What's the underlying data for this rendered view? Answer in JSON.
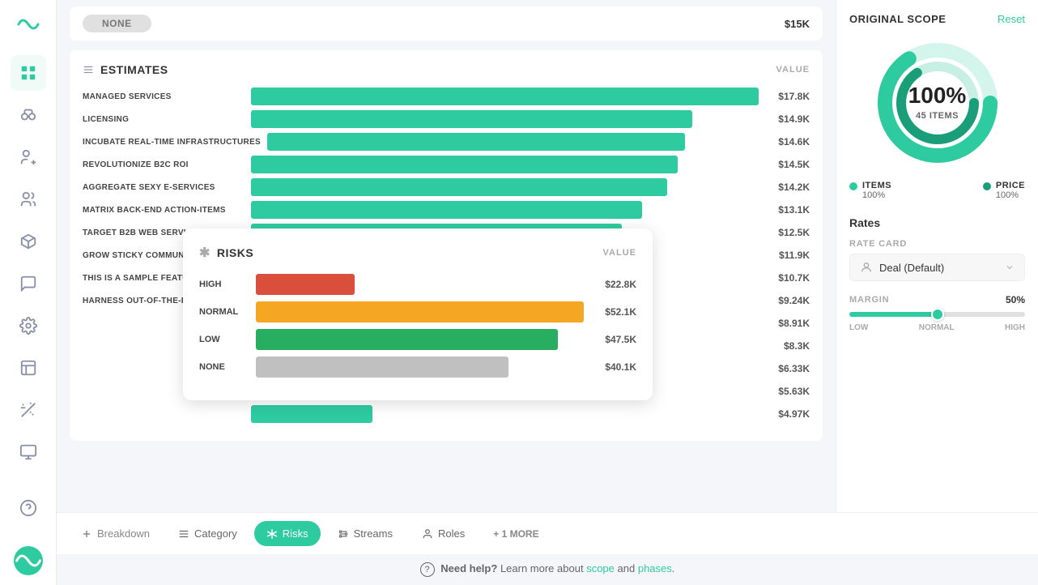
{
  "sidebar": {
    "logo_label": "~",
    "items": [
      {
        "name": "apps",
        "icon": "grid",
        "active": true
      },
      {
        "name": "binoculars",
        "icon": "binoculars"
      },
      {
        "name": "user-money",
        "icon": "user-money"
      },
      {
        "name": "users",
        "icon": "users"
      },
      {
        "name": "cube",
        "icon": "cube"
      },
      {
        "name": "chat",
        "icon": "chat"
      },
      {
        "name": "settings",
        "icon": "settings"
      },
      {
        "name": "building",
        "icon": "building"
      },
      {
        "name": "wand",
        "icon": "wand"
      },
      {
        "name": "display",
        "icon": "display"
      },
      {
        "name": "help",
        "icon": "help"
      }
    ]
  },
  "top_bar": {
    "none_label": "NONE",
    "price": "$15K"
  },
  "estimates": {
    "title": "ESTIMATES",
    "value_label": "VALUE",
    "bars": [
      {
        "label": "MANAGED SERVICES",
        "value": "$17.8K",
        "pct": 100
      },
      {
        "label": "LICENSING",
        "value": "$14.9K",
        "pct": 87
      },
      {
        "label": "INCUBATE REAL-TIME INFRASTRUCTURES",
        "value": "$14.6K",
        "pct": 85
      },
      {
        "label": "REVOLUTIONIZE B2C ROI",
        "value": "$14.5K",
        "pct": 84
      },
      {
        "label": "AGGREGATE SEXY E-SERVICES",
        "value": "$14.2K",
        "pct": 82
      },
      {
        "label": "MATRIX BACK-END ACTION-ITEMS",
        "value": "$13.1K",
        "pct": 77
      },
      {
        "label": "TARGET B2B WEB SERVICES",
        "value": "$12.5K",
        "pct": 73
      },
      {
        "label": "GROW STICKY COMMUNITIES",
        "value": "$11.9K",
        "pct": 70
      },
      {
        "label": "THIS IS A SAMPLE FEATURE",
        "value": "$10.7K",
        "pct": 63
      },
      {
        "label": "HARNESS OUT-OF-THE-BOX USERS",
        "value": "$9.24K",
        "pct": 57
      },
      {
        "label": "",
        "value": "$8.91K",
        "pct": 50
      },
      {
        "label": "",
        "value": "$8.3K",
        "pct": 45
      },
      {
        "label": "",
        "value": "$6.33K",
        "pct": 36
      },
      {
        "label": "",
        "value": "$5.63K",
        "pct": 30
      },
      {
        "label": "",
        "value": "$4.97K",
        "pct": 24
      }
    ]
  },
  "risks": {
    "title": "RISKS",
    "value_label": "VALUE",
    "bars": [
      {
        "label": "HIGH",
        "value": "$22.8K",
        "pct": 30,
        "type": "high"
      },
      {
        "label": "NORMAL",
        "value": "$52.1K",
        "pct": 100,
        "type": "normal"
      },
      {
        "label": "LOW",
        "value": "$47.5K",
        "pct": 92,
        "type": "low"
      },
      {
        "label": "NONE",
        "value": "$40.1K",
        "pct": 77,
        "type": "none"
      }
    ]
  },
  "bottom_tabs": {
    "add_label": "Breakdown",
    "tabs": [
      {
        "label": "Category",
        "icon": "list",
        "active": false
      },
      {
        "label": "Risks",
        "icon": "asterisk",
        "active": true
      },
      {
        "label": "Streams",
        "icon": "streams",
        "active": false
      },
      {
        "label": "Roles",
        "icon": "person",
        "active": false
      }
    ],
    "more_label": "+ 1 MORE"
  },
  "footer": {
    "help_icon": "?",
    "need_help": "Need help?",
    "learn_text": "Learn more about",
    "scope_link": "scope",
    "and_text": "and",
    "phases_link": "phases",
    "period": "."
  },
  "right_panel": {
    "title": "ORIGINAL SCOPE",
    "reset_label": "Reset",
    "donut": {
      "percent": "100%",
      "items_label": "45 ITEMS"
    },
    "legend": [
      {
        "label": "ITEMS",
        "value": "100%",
        "color": "#2ecba1"
      },
      {
        "label": "PRICE",
        "value": "100%",
        "color": "#1a9e7a"
      }
    ],
    "rates_title": "Rates",
    "rate_card_label": "RATE CARD",
    "rate_card_value": "Deal (Default)",
    "margin_label": "MARGIN",
    "margin_value": "50%",
    "slider_fill_pct": 50,
    "slider_labels": [
      "LOW",
      "NORMAL",
      "HIGH"
    ]
  }
}
